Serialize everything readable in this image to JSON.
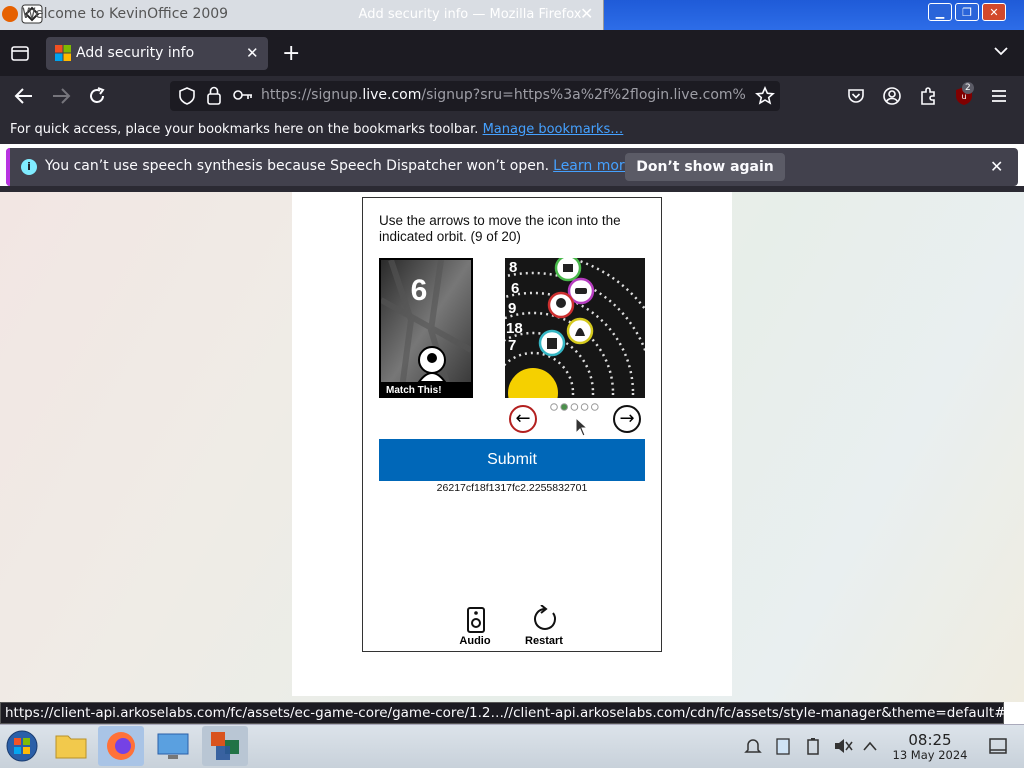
{
  "window": {
    "background_window_title": "Welcome to KevinOffice 2009",
    "title": "Add security info — Mozilla Firefox",
    "close_glyph": "✕"
  },
  "tabs": {
    "active_tab_title": "Add security info",
    "close_glyph": "✕",
    "new_tab_glyph": "+",
    "list_glyph": "⌄"
  },
  "navbar": {
    "url_prefix": "https://signup.",
    "url_domain": "live.com",
    "url_suffix": "/signup?sru=https%3a%2f%2flogin.live.com%",
    "extension_badge": "2"
  },
  "bookmarks": {
    "message": "For quick access, place your bookmarks here on the bookmarks toolbar.",
    "link": "Manage bookmarks…"
  },
  "notification": {
    "message": "You can’t use speech synthesis because Speech Dispatcher won’t open.",
    "link": "Learn more",
    "button": "Don’t show again",
    "close_glyph": "✕"
  },
  "captcha": {
    "instructions": "Use the arrows to move the icon into the indicated orbit. (9 of 20)",
    "match_number": "6",
    "match_label": "Match This!",
    "orbit_numbers": [
      "8",
      "6",
      "9",
      "18",
      "7"
    ],
    "left_arrow": "←",
    "right_arrow": "→",
    "submit_label": "Submit",
    "session_id": "26217cf18f1317fc2.2255832701",
    "audio_label": "Audio",
    "restart_label": "Restart",
    "dots_total": 5,
    "dots_active_index": 1
  },
  "status": {
    "url": "https://client-api.arkoselabs.com/fc/assets/ec-game-core/game-core/1.2…//client-api.arkoselabs.com/cdn/fc/assets/style-manager&theme=default#"
  },
  "taskbar": {
    "time": "08:25",
    "date": "13 May 2024"
  },
  "colors": {
    "firefox_dark": "#1c1b22",
    "toolbar": "#2b2a33",
    "link": "#45a1ff",
    "submit": "#0067b8"
  }
}
